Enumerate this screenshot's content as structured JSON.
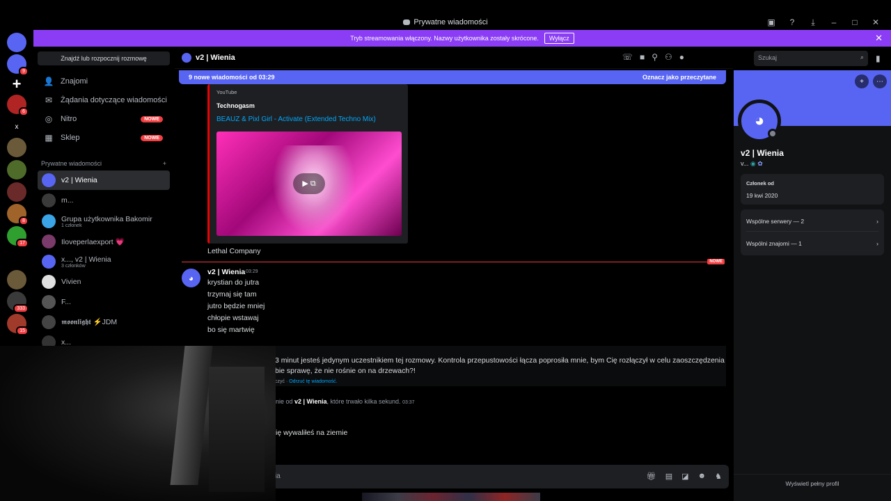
{
  "window": {
    "title": "Prywatne wiadomości"
  },
  "banner": {
    "text": "Tryb streamowania włączony. Nazwy użytkownika zostały skrócone.",
    "button": "Wyłącz"
  },
  "servers": [
    {
      "label": "",
      "color": "#5865f2",
      "badge": ""
    },
    {
      "label": "",
      "color": "#5865f2",
      "badge": "9"
    },
    {
      "label": "+",
      "color": "#000000",
      "badge": ""
    },
    {
      "label": "",
      "color": "#b02424",
      "badge": "6"
    },
    {
      "label": "x",
      "color": "#000000",
      "badge": ""
    },
    {
      "label": "",
      "color": "#6b5a3a",
      "badge": ""
    },
    {
      "label": "",
      "color": "#4f6b2a",
      "badge": ""
    },
    {
      "label": "",
      "color": "#6b2a2a",
      "badge": ""
    },
    {
      "label": "",
      "color": "#a0632a",
      "badge": "8"
    },
    {
      "label": "",
      "color": "#2fa02f",
      "badge": "17"
    },
    {
      "label": "",
      "color": "#000000",
      "badge": ""
    },
    {
      "label": "",
      "color": "#6b5a3a",
      "badge": ""
    },
    {
      "label": "",
      "color": "#3a3a3a",
      "badge": "333"
    },
    {
      "label": "",
      "color": "#a03a2a",
      "badge": "15"
    }
  ],
  "dm_sidebar": {
    "search_label": "Znajdź lub rozpocznij rozmowę",
    "nav": [
      {
        "label": "Znajomi",
        "badge": ""
      },
      {
        "label": "Żądania dotyczące wiadomości",
        "badge": ""
      },
      {
        "label": "Nitro",
        "badge": "NOWE"
      },
      {
        "label": "Sklep",
        "badge": "NOWE"
      }
    ],
    "section_title": "Prywatne wiadomości",
    "dms": [
      {
        "name": "v2 | Wienia",
        "sub": "",
        "color": "#5865f2"
      },
      {
        "name": "m...",
        "sub": "",
        "color": "#3a3a3a"
      },
      {
        "name": "Grupa użytkownika Bakomir",
        "sub": "1 członek",
        "color": "#3ba4e6"
      },
      {
        "name": "Iloveperlaexport 💗",
        "sub": "",
        "color": "#7a3a6a"
      },
      {
        "name": "x..., v2 | Wienia",
        "sub": "3 członków",
        "color": "#5865f2"
      },
      {
        "name": "Vivien",
        "sub": "",
        "color": "#e0e0e0"
      },
      {
        "name": "F...",
        "sub": "",
        "color": "#555555"
      },
      {
        "name": "𝖒𝖔𝖔𝖓𝖑𝖎𝖌𝖍𝖙 ⚡JDM",
        "sub": "",
        "color": "#444444"
      },
      {
        "name": "x...",
        "sub": "",
        "color": "#333333"
      }
    ]
  },
  "chat": {
    "header_name": "v2 | Wienia",
    "search_placeholder": "Szukaj",
    "new_messages": "9 nowe wiadomości od 03:29",
    "mark_read": "Oznacz jako przeczytane",
    "embed": {
      "provider": "YouTube",
      "author": "Technogasm",
      "title": "BEAUZ & Pixl Girl - Activate (Extended Techno Mix)"
    },
    "prev_text": "Lethal Company",
    "divider_badge": "NOWE",
    "message": {
      "author": "v2 | Wienia",
      "time": "03:29",
      "lines": [
        "krystian do jutra",
        "trzymaj się tam",
        "jutro będzie mniej",
        "chłopie wstawaj",
        "bo się martwię"
      ]
    },
    "system": {
      "line1": "3 minut jesteś jedynym uczestnikiem tej rozmowy. Kontrola przepustowości łącza poprosiła mnie, bym Cię rozłączył w celu zaoszczędzenia",
      "line2": "bie sprawę, że nie rośnie on na drzewach?!",
      "foot_prefix": "czyć · ",
      "foot_link": "Odrzuć tę wiadomość."
    },
    "call": {
      "prefix": "nie od ",
      "name": "v2 | Wienia",
      "suffix": ", które trwało kilka sekund.",
      "time": "03:37"
    },
    "last_line": "ię wywaliłeś na ziemie",
    "composer_placeholder": "ia"
  },
  "profile": {
    "name": "v2 | Wienia",
    "username": "v...",
    "member_label": "Członek od",
    "member_since": "19 kwi 2020",
    "servers": "Wspólne serwery — 2",
    "friends": "Wspólni znajomi — 1",
    "full_profile": "Wyświetl pełny profil"
  },
  "colors": {
    "accent": "#5865f2",
    "banner": "#8b3df5",
    "danger": "#f23f43",
    "link": "#00a8fc"
  }
}
